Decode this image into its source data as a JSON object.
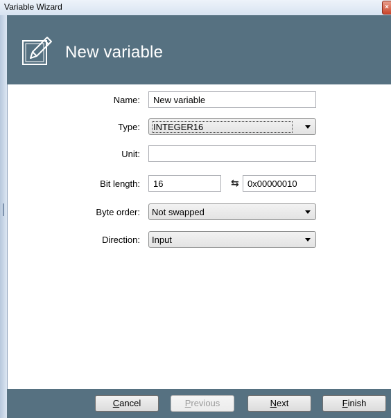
{
  "window": {
    "title": "Variable Wizard",
    "close_glyph": "×"
  },
  "header": {
    "title": "New variable",
    "icon": "edit-pencil-icon"
  },
  "form": {
    "name_label": "Name:",
    "name_value": "New variable",
    "type_label": "Type:",
    "type_value": "INTEGER16",
    "unit_label": "Unit:",
    "unit_value": "",
    "bitlength_label": "Bit length:",
    "bitlength_value": "16",
    "swap_glyph": "⇆",
    "bitlength_hex": "0x00000010",
    "byteorder_label": "Byte order:",
    "byteorder_value": "Not swapped",
    "direction_label": "Direction:",
    "direction_value": "Input"
  },
  "buttons": {
    "cancel": {
      "mnemonic": "C",
      "rest": "ancel"
    },
    "previous": {
      "mnemonic": "P",
      "rest": "revious"
    },
    "next": {
      "mnemonic": "N",
      "rest": "ext"
    },
    "finish": {
      "mnemonic": "F",
      "rest": "inish"
    }
  },
  "colors": {
    "header": "#567181",
    "footer": "#567181"
  }
}
